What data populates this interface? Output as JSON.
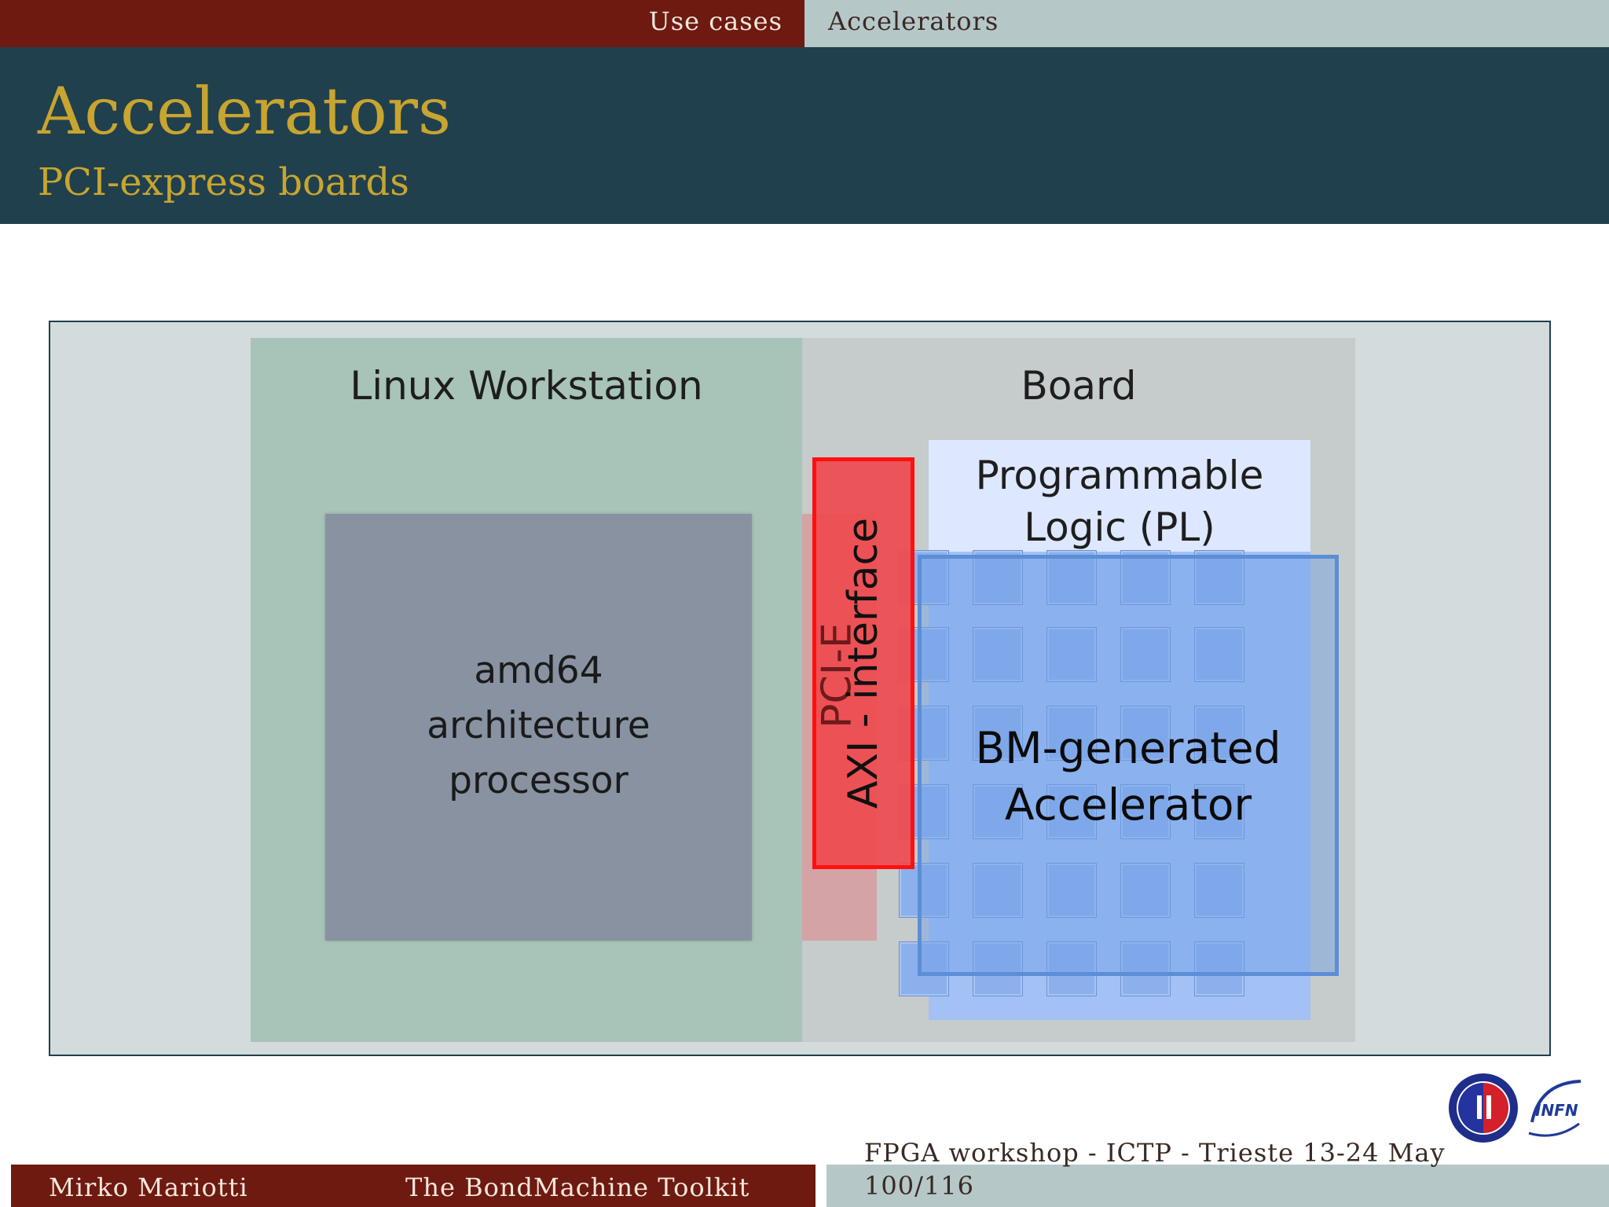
{
  "nav": {
    "section": "Use cases",
    "subsection": "Accelerators"
  },
  "slide": {
    "title": "Accelerators",
    "subtitle": "PCI-express boards"
  },
  "diagram": {
    "workstation_label": "Linux Workstation",
    "board_label": "Board",
    "processor_lines": [
      "amd64",
      "architecture",
      "processor"
    ],
    "pcie_label": "PCI-E",
    "axi_label": "AXI - interface",
    "pl_lines": [
      "Programmable",
      "Logic (PL)"
    ],
    "accel_lines": [
      "BM-generated",
      "Accelerator"
    ]
  },
  "footer": {
    "author": "Mirko Mariotti",
    "title": "The BondMachine Toolkit",
    "event": "FPGA workshop - ICTP - Trieste 13-24 May",
    "page": "100/116"
  },
  "colors": {
    "primary_dark": "#21404d",
    "accent_red": "#6e1a10",
    "title_gold": "#c8a530",
    "light_band": "#b6c7c8"
  }
}
